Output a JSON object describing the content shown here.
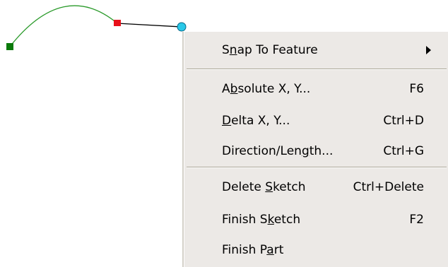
{
  "menu": {
    "items": [
      {
        "label_pre": "S",
        "label_ul": "n",
        "label_post": "ap To Feature",
        "shortcut": "",
        "submenu": true
      },
      {
        "label_pre": "A",
        "label_ul": "b",
        "label_post": "solute X, Y...",
        "shortcut": "F6",
        "submenu": false
      },
      {
        "label_pre": "",
        "label_ul": "D",
        "label_post": "elta X, Y...",
        "shortcut": "Ctrl+D",
        "submenu": false
      },
      {
        "label_pre": "Direction/Len",
        "label_ul": "g",
        "label_post": "th...",
        "shortcut": "Ctrl+G",
        "submenu": false
      },
      {
        "label_pre": "Delete ",
        "label_ul": "S",
        "label_post": "ketch",
        "shortcut": "Ctrl+Delete",
        "submenu": false
      },
      {
        "label_pre": "Finish S",
        "label_ul": "k",
        "label_post": "etch",
        "shortcut": "F2",
        "submenu": false
      },
      {
        "label_pre": "Finish P",
        "label_ul": "a",
        "label_post": "rt",
        "shortcut": "",
        "submenu": false
      }
    ]
  },
  "colors": {
    "arc": "#2a9a2a",
    "start_vertex": "#0a7a0a",
    "mid_vertex": "#e8101a",
    "segment": "#000000",
    "cursor_vertex": "#29c8e8",
    "menu_bg": "#ece9e6"
  }
}
